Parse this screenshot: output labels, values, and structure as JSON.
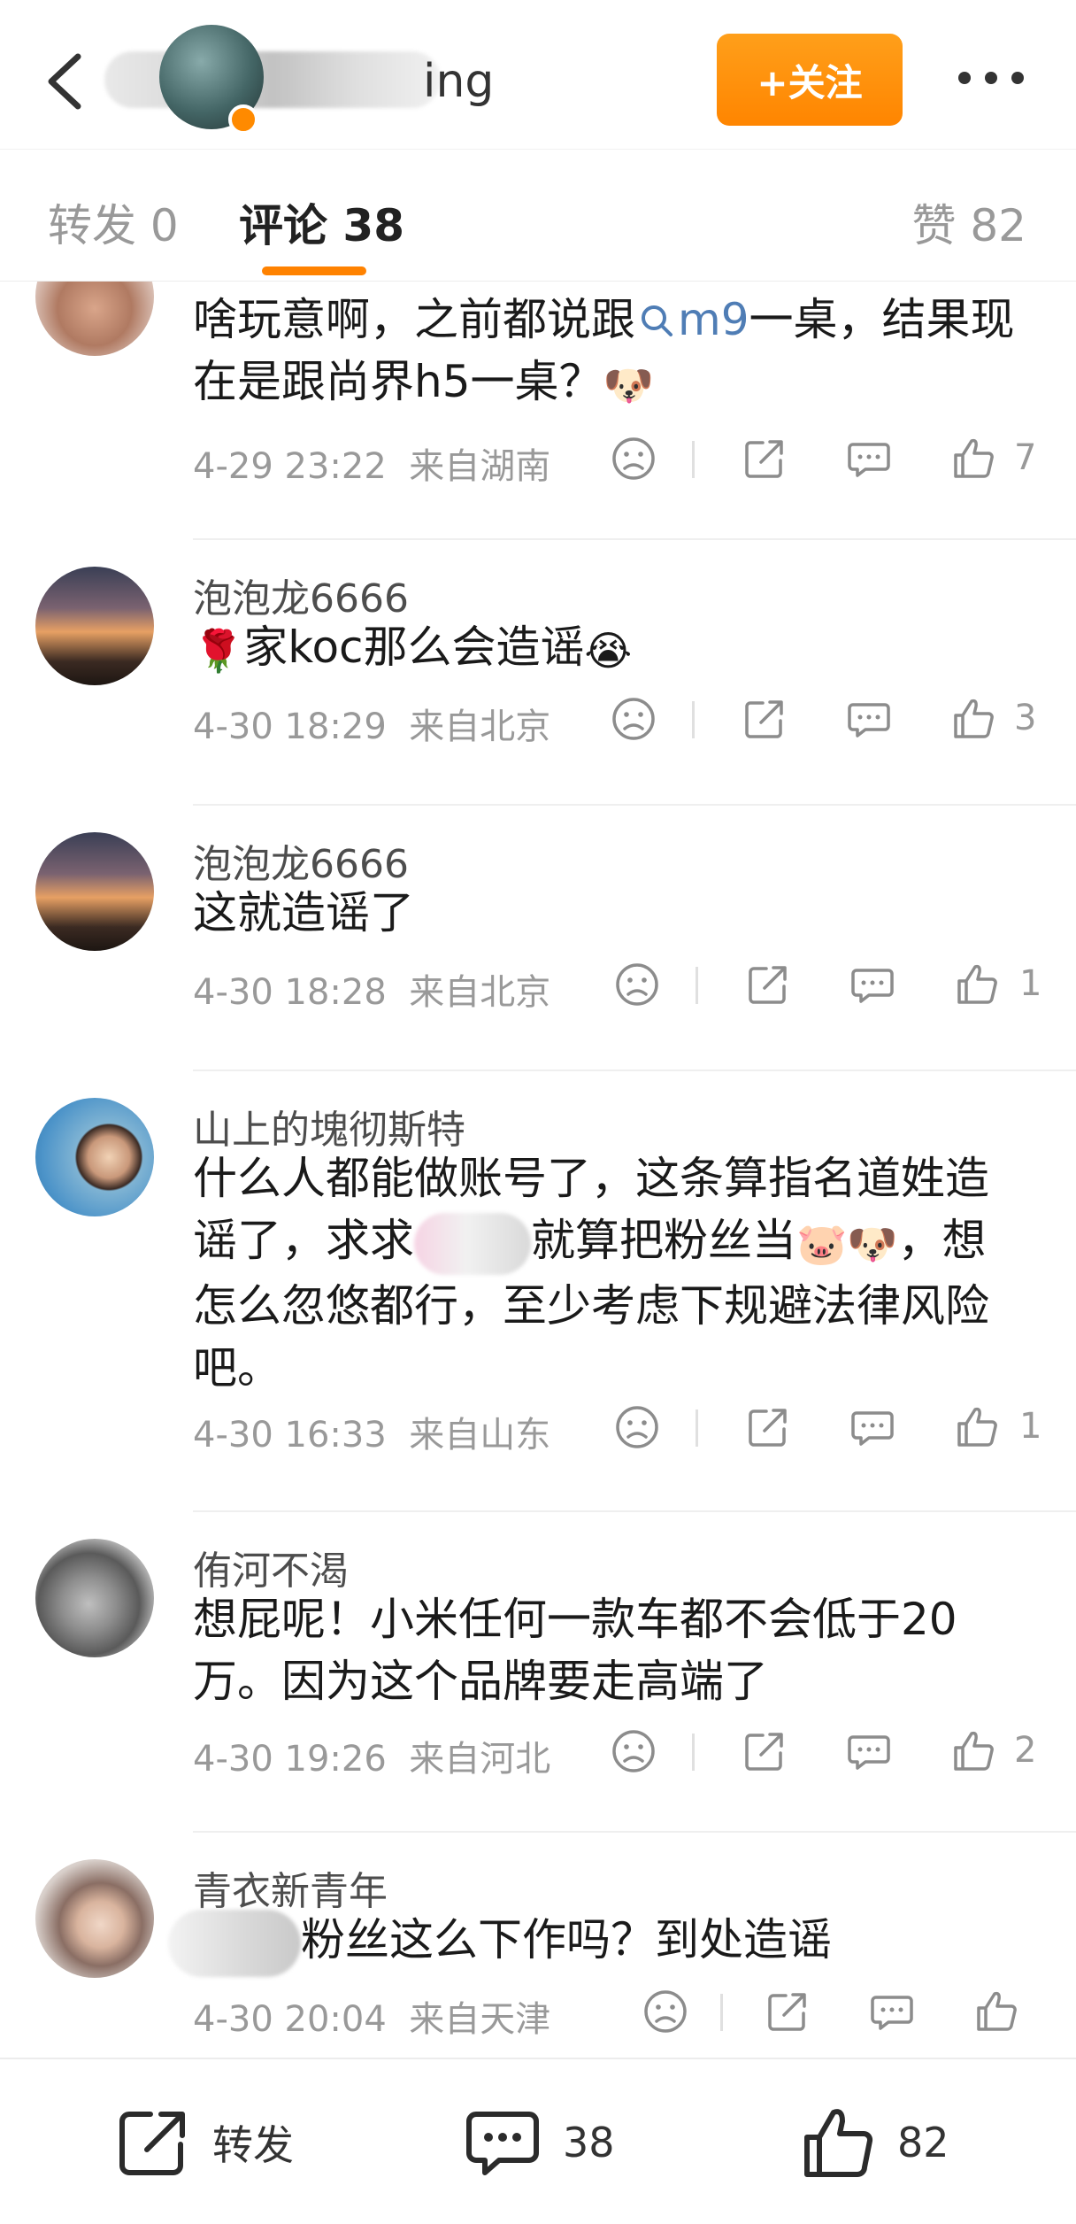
{
  "header": {
    "name_visible_suffix": "ing",
    "follow_label": "+关注",
    "back_icon": "chevron-left-icon",
    "more_icon": "more-dots-icon"
  },
  "tabs": {
    "repost": "转发 0",
    "comment": "评论 38",
    "like": "赞 82",
    "active_color": "#ff8200"
  },
  "comments": [
    {
      "user": "",
      "text_part1": "啥玩意啊，之前都说跟",
      "search_link": "m9",
      "text_part2": "一桌，结果现在是跟尚界h5一桌？",
      "emoji": "🐶",
      "time": "4-29 23:22",
      "location": "来自湖南",
      "likes": "7"
    },
    {
      "user": "泡泡龙6666",
      "emoji": "🌹",
      "text": "家koc那么会造谣",
      "emoji2": "😭",
      "time": "4-30 18:29",
      "location": "来自北京",
      "likes": "3"
    },
    {
      "user": "泡泡龙6666",
      "text": "这就造谣了",
      "time": "4-30 18:28",
      "location": "来自北京",
      "likes": "1"
    },
    {
      "user": "山上的塊彻斯特",
      "text_line1": "什么人都能做账号了，这条算指名道姓造",
      "text_line2a": "谣了，求求",
      "text_line2b": "就算把粉丝当",
      "emoji_pig": "🐷",
      "emoji_dog": "🐶",
      "text_line2c": "，想",
      "text_line3": "怎么忽悠都行，至少考虑下规避法律风险",
      "text_line4": "吧。",
      "time": "4-30 16:33",
      "location": "来自山东",
      "likes": "1"
    },
    {
      "user": "侑河不渴",
      "text_line1": "想屁呢！小米任何一款车都不会低于20",
      "text_line2": "万。因为这个品牌要走高端了",
      "time": "4-30 19:26",
      "location": "来自河北",
      "likes": "2"
    },
    {
      "user": "青衣新青年",
      "text": "粉丝这么下作吗？到处造谣",
      "time": "4-30 20:04",
      "location": "来自天津",
      "likes": ""
    }
  ],
  "bottom_bar": {
    "repost_label": "转发",
    "comment_count": "38",
    "like_count": "82"
  },
  "colors": {
    "accent": "#ff8200",
    "link": "#4f7db5",
    "meta_text": "#999999"
  }
}
